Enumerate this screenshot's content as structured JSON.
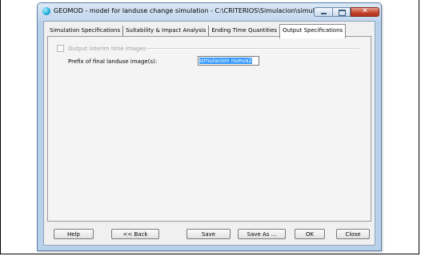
{
  "window": {
    "title": "GEOMOD - model for landuse change simulation - C:\\CRITERIOS\\Simulacion\\simulacion n..."
  },
  "tabs": [
    {
      "label": "Simulation Specifications"
    },
    {
      "label": "Suitability & Impact Analysis"
    },
    {
      "label": "Ending Time Quantities"
    },
    {
      "label": "Output Specifications"
    }
  ],
  "active_tab": "Output Specifications",
  "output": {
    "interim_checkbox_label": "Output interim time images",
    "interim_checked": false,
    "prefix_label": "Prefix of final landuse image(s):",
    "prefix_value": "simulacion nueva2"
  },
  "buttons": {
    "help": "Help",
    "back": "<< Back",
    "save": "Save",
    "save_as": "Save As ...",
    "ok": "OK",
    "close": "Close"
  },
  "icons": {
    "app": "geomod-app-icon",
    "minimize": "minimize-icon",
    "maximize": "maximize-icon",
    "close": "close-icon"
  }
}
